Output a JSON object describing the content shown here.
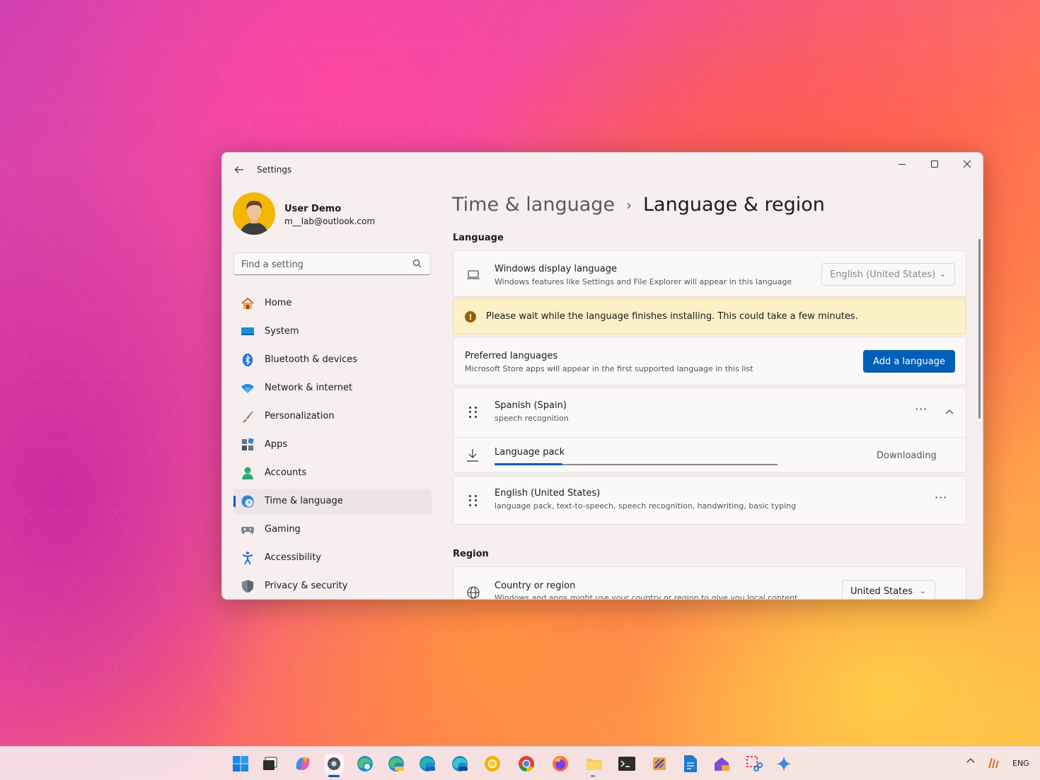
{
  "window": {
    "title": "Settings",
    "controls": {
      "minimize": "minimize",
      "maximize": "maximize",
      "close": "close"
    }
  },
  "profile": {
    "name": "User Demo",
    "email": "m__lab@outlook.com"
  },
  "search": {
    "placeholder": "Find a setting"
  },
  "nav": {
    "items": [
      {
        "label": "Home",
        "icon": "home-icon"
      },
      {
        "label": "System",
        "icon": "system-icon"
      },
      {
        "label": "Bluetooth & devices",
        "icon": "bluetooth-icon"
      },
      {
        "label": "Network & internet",
        "icon": "wifi-icon"
      },
      {
        "label": "Personalization",
        "icon": "brush-icon"
      },
      {
        "label": "Apps",
        "icon": "apps-icon"
      },
      {
        "label": "Accounts",
        "icon": "accounts-icon"
      },
      {
        "label": "Time & language",
        "icon": "globe-clock-icon",
        "active": true
      },
      {
        "label": "Gaming",
        "icon": "gamepad-icon"
      },
      {
        "label": "Accessibility",
        "icon": "accessibility-icon"
      },
      {
        "label": "Privacy & security",
        "icon": "shield-icon"
      }
    ]
  },
  "breadcrumb": {
    "parent": "Time & language",
    "separator": "›",
    "current": "Language & region"
  },
  "language": {
    "section_title": "Language",
    "display_language": {
      "title": "Windows display language",
      "subtitle": "Windows features like Settings and File Explorer will appear in this language",
      "value": "English (United States)"
    },
    "warning": "Please wait while the language finishes installing. This could take a few minutes.",
    "preferred": {
      "title": "Preferred languages",
      "subtitle": "Microsoft Store apps will appear in the first supported language in this list",
      "button": "Add a language"
    },
    "languages": [
      {
        "name": "Spanish (Spain)",
        "features": "speech recognition"
      },
      {
        "name": "English (United States)",
        "features": "language pack, text-to-speech, speech recognition, handwriting, basic typing"
      }
    ],
    "download": {
      "title": "Language pack",
      "status": "Downloading",
      "progress": 0.24
    }
  },
  "region": {
    "section_title": "Region",
    "country": {
      "title": "Country or region",
      "subtitle": "Windows and apps might use your country or region to give you local content",
      "value": "United States"
    }
  },
  "taskbar": {
    "icons": [
      "start-icon",
      "task-view-icon",
      "copilot-icon",
      "settings-icon",
      "edge-icon",
      "edge-canary-icon",
      "edge-beta-icon",
      "edge-dev-icon",
      "chrome-canary-icon",
      "chrome-icon",
      "firefox-icon",
      "file-explorer-icon",
      "terminal-icon",
      "paint-icon",
      "notepad-icon",
      "dev-home-icon",
      "snipping-tool-icon",
      "spark-icon"
    ],
    "tray_language": "ENG"
  },
  "colors": {
    "accent": "#005fb8",
    "warning_bg": "#fbf0c6",
    "window_bg": "#f6eeef"
  }
}
